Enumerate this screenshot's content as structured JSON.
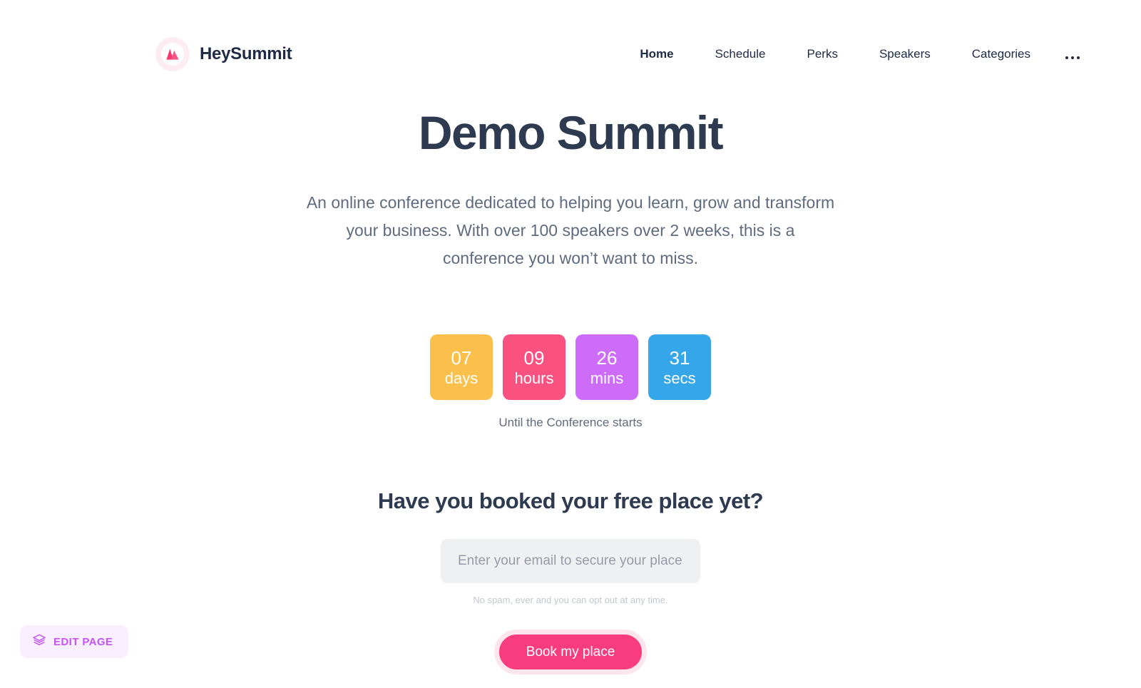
{
  "brand": {
    "name": "HeySummit",
    "logo_icon": "mountain-logo-icon",
    "logo_color": "#f9386f",
    "logo_ring_color": "#fdecf2"
  },
  "nav": {
    "items": [
      {
        "label": "Home",
        "active": true
      },
      {
        "label": "Schedule",
        "active": false
      },
      {
        "label": "Perks",
        "active": false
      },
      {
        "label": "Speakers",
        "active": false
      },
      {
        "label": "Categories",
        "active": false
      }
    ],
    "more_icon": "ellipsis-icon"
  },
  "hero": {
    "title": "Demo Summit",
    "subtitle": "An online conference dedicated to helping you learn, grow and transform your business. With over 100 speakers over 2 weeks, this is a conference you won’t want to miss."
  },
  "countdown": {
    "caption": "Until the Conference starts",
    "units": [
      {
        "value": "07",
        "label": "days",
        "color": "#fbbf4c"
      },
      {
        "value": "09",
        "label": "hours",
        "color": "#fa5280"
      },
      {
        "value": "26",
        "label": "mins",
        "color": "#cc6cf8"
      },
      {
        "value": "31",
        "label": "secs",
        "color": "#36a6eb"
      }
    ]
  },
  "signup": {
    "title": "Have you booked your free place yet?",
    "email_placeholder": "Enter your email to secure your place",
    "email_value": "",
    "fineprint": "No spam, ever and you can opt out at any time.",
    "submit_label": "Book my place",
    "submit_color": "#f93c7e"
  },
  "edit_page": {
    "label": "EDIT PAGE",
    "icon": "layers-icon",
    "color": "#c455f5"
  }
}
